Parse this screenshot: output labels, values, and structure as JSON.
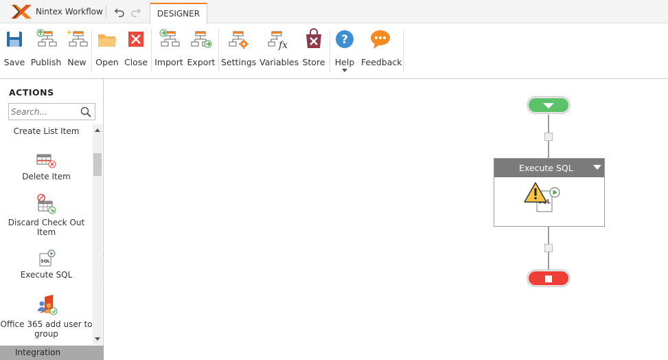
{
  "app": {
    "brand": "Nintex Workflow",
    "active_tab": "DESIGNER"
  },
  "ribbon": [
    {
      "id": "save",
      "label": "Save",
      "icon": "save-icon"
    },
    {
      "id": "publish",
      "label": "Publish",
      "icon": "publish-icon"
    },
    {
      "id": "new",
      "label": "New",
      "icon": "new-icon"
    },
    {
      "id": "open",
      "label": "Open",
      "icon": "folder-icon"
    },
    {
      "id": "close",
      "label": "Close",
      "icon": "close-icon"
    },
    {
      "id": "import",
      "label": "Import",
      "icon": "import-icon"
    },
    {
      "id": "export",
      "label": "Export",
      "icon": "export-icon"
    },
    {
      "id": "settings",
      "label": "Settings",
      "icon": "settings-icon"
    },
    {
      "id": "variables",
      "label": "Variables",
      "icon": "variables-icon"
    },
    {
      "id": "store",
      "label": "Store",
      "icon": "store-icon"
    },
    {
      "id": "help",
      "label": "Help",
      "icon": "help-icon"
    },
    {
      "id": "feedback",
      "label": "Feedback",
      "icon": "feedback-icon"
    }
  ],
  "sidebar": {
    "title": "ACTIONS",
    "search_placeholder": "Search...",
    "items": [
      {
        "label": "Create List Item",
        "icon": ""
      },
      {
        "label": "Delete Item",
        "icon": "delete-item-icon"
      },
      {
        "label": "Discard Check Out Item",
        "icon": "discard-checkout-icon"
      },
      {
        "label": "Execute SQL",
        "icon": "execute-sql-icon"
      },
      {
        "label": "Office 365 add user to group",
        "icon": "office365-add-user-icon"
      }
    ],
    "category": "Integration"
  },
  "canvas": {
    "action": {
      "title": "Execute SQL",
      "status": "warning",
      "icon": "execute-sql-icon"
    }
  },
  "colors": {
    "accent": "#f07f21",
    "start": "#5cc26a",
    "end": "#ef3e36",
    "action_header": "#7b7b7b",
    "save": "#2b6ca8",
    "help": "#3d8fd1",
    "feedback": "#f58a1f"
  }
}
